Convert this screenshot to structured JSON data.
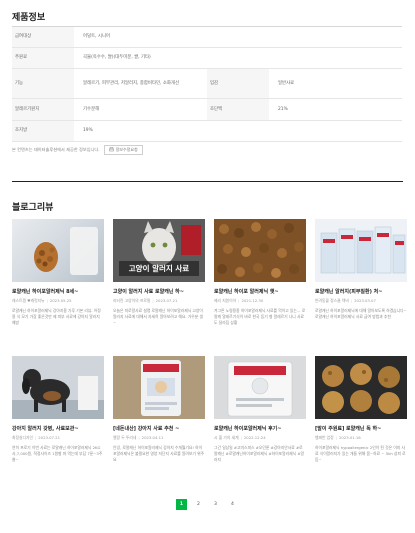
{
  "product_info": {
    "title": "제품정보",
    "rows": [
      {
        "label": "급여대상",
        "value": "어덜트, 시니어"
      },
      {
        "label": "주원료",
        "value": "곡물(옥수수, 쌀)(대두미분, 쌀, 기타)"
      },
      {
        "label": "기능",
        "value": "알레르기, 피부관리, 저알러지, 종합비타민, 소화개선",
        "label2": "입감",
        "value2": "일반사료"
      },
      {
        "label": "알레르기원지",
        "value": "기수분해",
        "label2": "조단백",
        "value2": "21%"
      },
      {
        "label": "조지방",
        "value": "19%"
      }
    ],
    "notice_prefix": "본 컨텐츠는",
    "notice_source": "데이터솔루션",
    "notice_suffix": "에서 제공한 정보입니다.",
    "report_label": "정보수정요청"
  },
  "blog_review": {
    "title": "블로그리뷰",
    "cards": [
      {
        "title": "로얄캐닌 하이포알러제닉 8세~",
        "author": "래스트랭 ♥캐럿지뉴",
        "date": "2023.05.25",
        "excerpt": "로얄캐닌 하이포알러제닉 강아지용 가루 기본 리뷰. 어정용 식 모기 가장 좋은것만 제 피부 사료에 강아지 알러지 예방"
      },
      {
        "title": "고양이 알러지 사료 로얄캐닌 하~",
        "author": "리터린 고양이의 프로필",
        "date": "2023.07.21",
        "excerpt": "오늘은 미로알사료 설명 로얄캐닌 하이포알러제닉 고양이 알러지 사료에 대해서 자세히 알아보려고 해요. 가우분 생~"
      },
      {
        "title": "로얄캐닌 하이포 알러제닉 햇~",
        "author": "제리 지원이아",
        "date": "2021.12.30",
        "excerpt": "겨그른 노령용종 하이포알러제닉 사료를 먹이고 있는... 로얄캐 알레르기식이 바로 한국 등기 형 알레르기 나니 사료도 달라짐 상황"
      },
      {
        "title": "로얄캐닌 알러지(피부질환) 처~",
        "author": "반려동물 정스쿨 텍비",
        "date": "2023.03.07",
        "excerpt": "로얄캐닌 하이포알러제닉에 대해 알아보도록 하겠습니다~ 로얄캐닌 하이포알러제닉 사료 급여 방법과 추천"
      },
      {
        "title": "강아지 알러지 갖병, 사료보관~",
        "author": "최정실디자인",
        "date": "2023.07.21",
        "excerpt": "연히 프로기 이번 사료는 로얄캐닌 하이포알러제닉 2KG 사,7,000원, 적정사이즈 1원형 마 먹는데 부담 7푼~3주 쓸~"
      },
      {
        "title": "[네돈내산] 강아지 사료 추천 ~",
        "author": "멜랑 두 뚜리네",
        "date": "2023.04.11",
        "excerpt": "안녕, 로얄캐닌 하이포알러제닉 강아지 수개월기요! 하이포알러제닉은 불필요한 영양 저단지 사료를 알려보기 위주요"
      },
      {
        "title": "로얄캐닌 하이포알러제닉 후기~",
        "author": "시 풀 가의 세계",
        "date": "2022.12.24",
        "excerpt": "그간 일상일 #고미스피스 #오던룬 #강아지안사료 #로얄캐닌 #로얄캐닌하이포알러제닉 #하이포알러제닉 #알러지"
      },
      {
        "title": "[말이 주원료] 로얄캐닌 독 하~",
        "author": "햄찌반 업정",
        "date": "2023.01.16",
        "excerpt": "하이포알러제닉 hypoallergenic 2인이 된 것은 이미 사료 식이알러지가 있는 개들 위해 몸~하료 ~ 5kh 성피 로듬~"
      }
    ]
  },
  "pagination": {
    "pages": [
      "1",
      "2",
      "3",
      "4"
    ],
    "current": "1"
  },
  "colors": {
    "accent": "#00b843",
    "divider": "#222222"
  }
}
